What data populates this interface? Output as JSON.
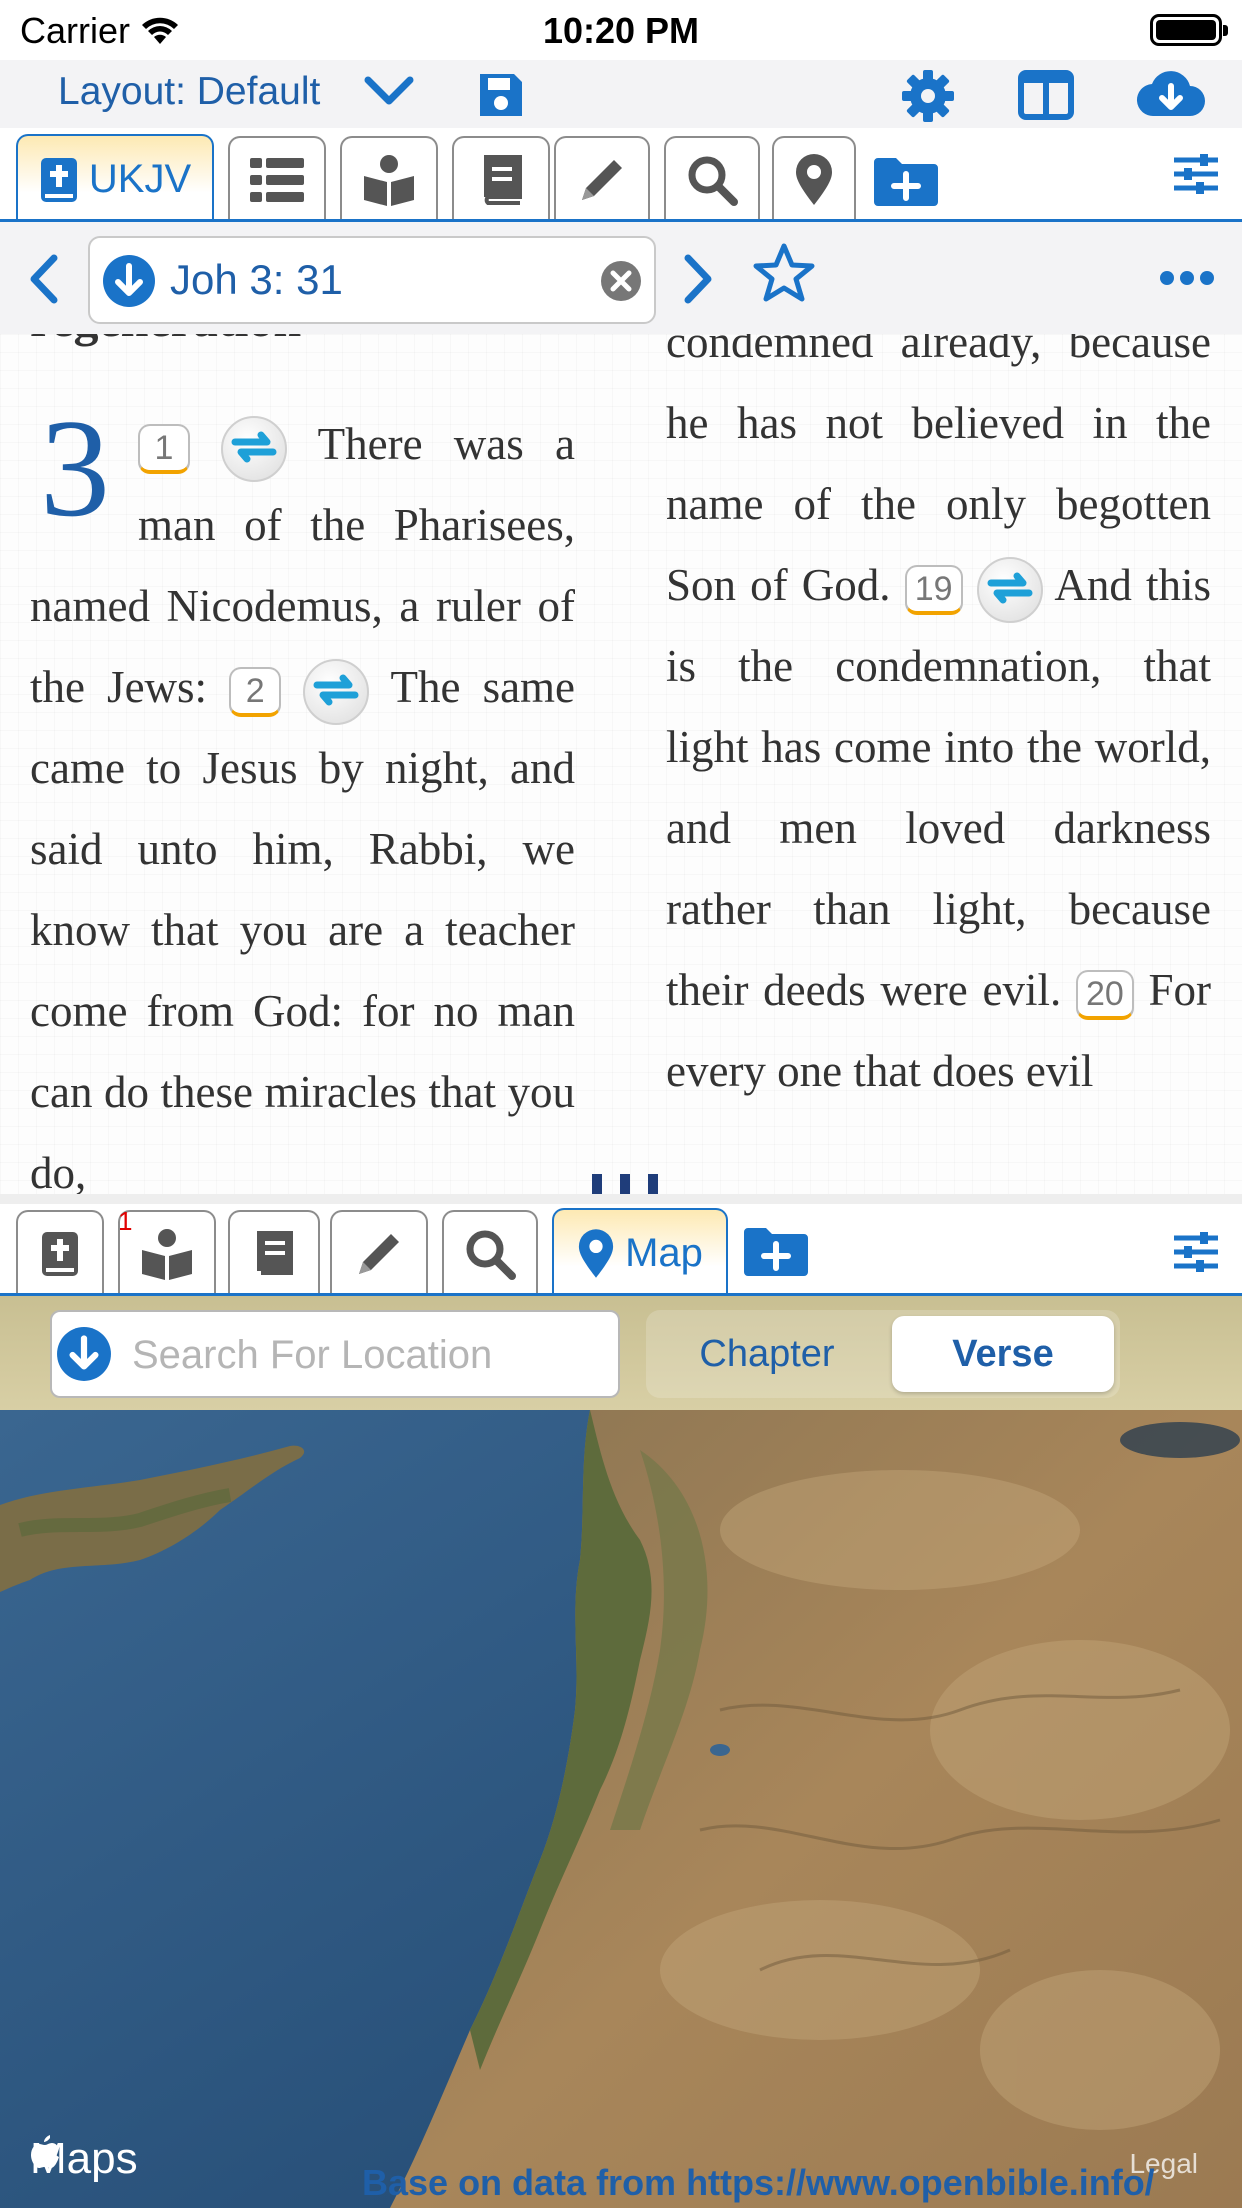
{
  "status": {
    "carrier": "Carrier",
    "time": "10:20 PM"
  },
  "layout": {
    "label": "Layout: Default"
  },
  "top_tabs": {
    "active_label": "UKJV"
  },
  "reference": {
    "value": "Joh 3: 31"
  },
  "reader": {
    "heading_fragment": "regeneration",
    "chapter": "3",
    "left": {
      "v1_num": "1",
      "v1_text": "There was a man of the Pharisees, named Nicodemus, a ruler of the Jews:",
      "v2_num": "2",
      "v2_text": "The same came to Jesus by night, and said unto him, Rabbi, we know that you are a teacher come from God: for no man can do these miracles that you do,"
    },
    "right": {
      "cont_text": "condemned already, because he has not believed in the name of the only begotten Son of God.",
      "v19_num": "19",
      "v19_text": "And this is the condemnation, that light has come into the world, and men loved darkness rather than light, because their deeds were evil.",
      "v20_num": "20",
      "v20_text": "For every one that does evil"
    }
  },
  "bottom_tabs": {
    "map_label": "Map",
    "study_badge": "1"
  },
  "map_panel": {
    "search_placeholder": "Search For Location",
    "segment_chapter": "Chapter",
    "segment_verse": "Verse",
    "maps_label": "Maps",
    "legal": "Legal",
    "attribution": "Base on data from  https://www.openbible.info/"
  },
  "colors": {
    "accent": "#1a73c8",
    "text_blue": "#1f5fa8",
    "verse_underline": "#f2a300"
  }
}
